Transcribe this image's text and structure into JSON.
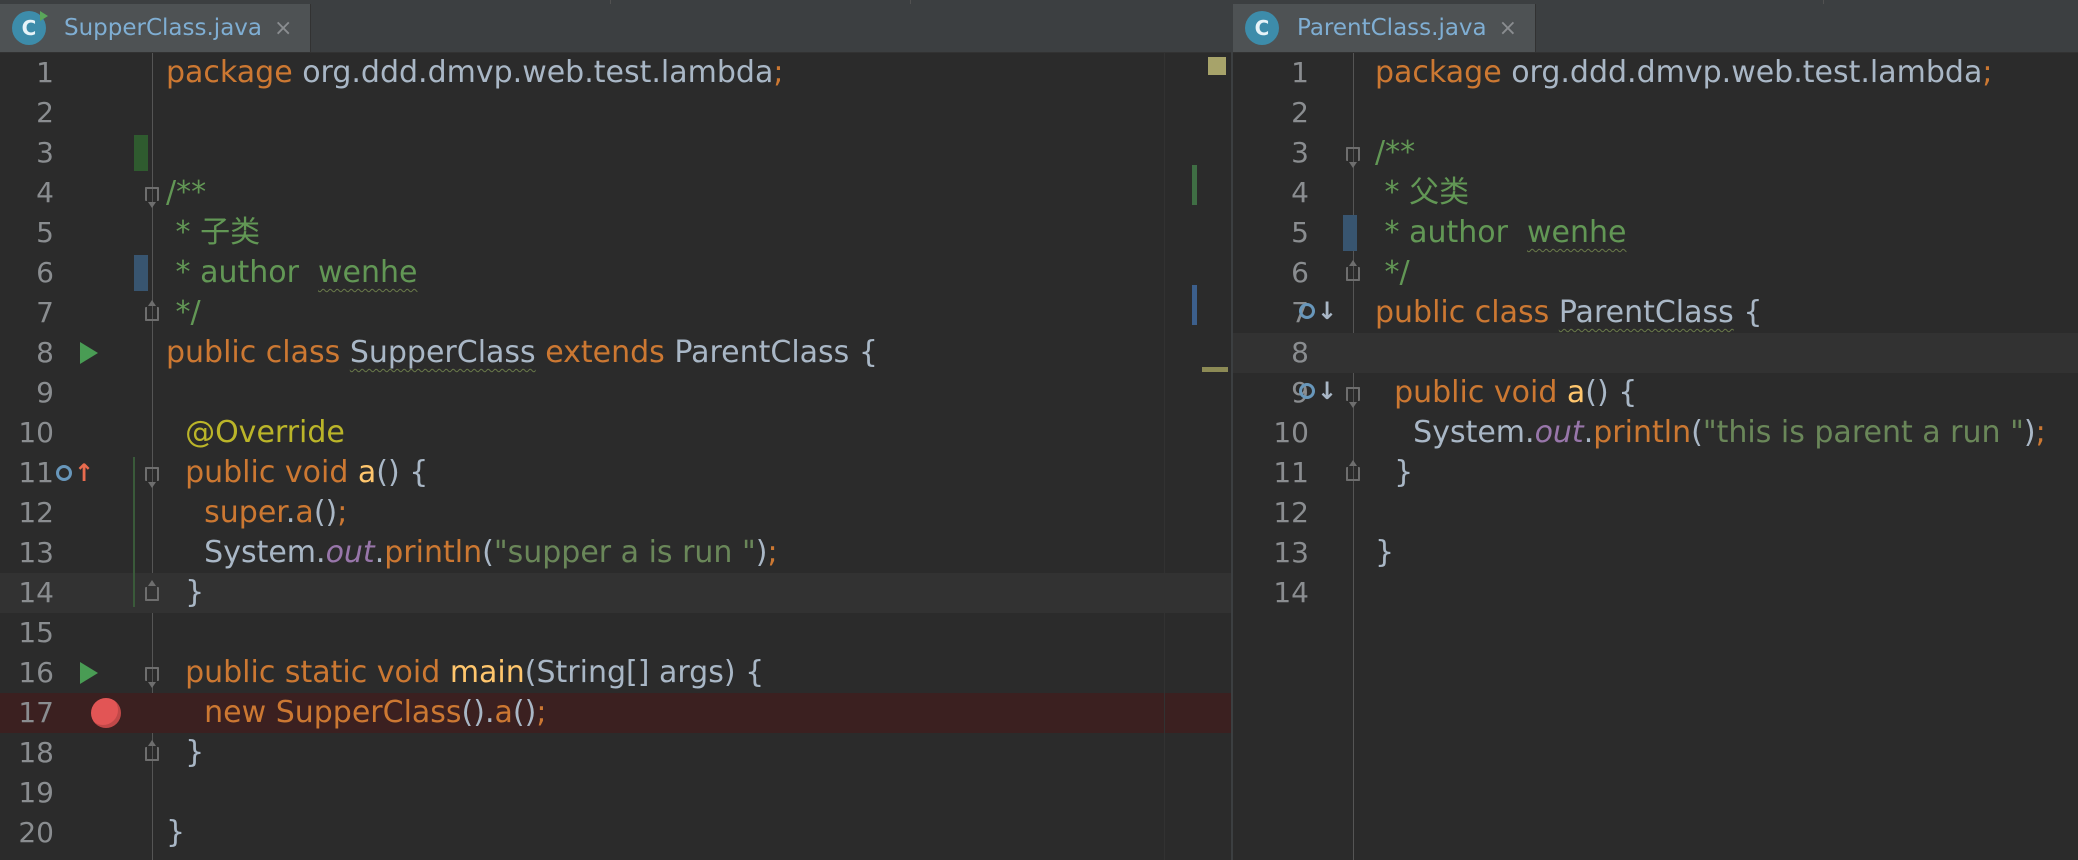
{
  "left": {
    "tab": {
      "icon": "class-file-icon",
      "filename": "SupperClass.java",
      "close": "×"
    },
    "lines": [
      {
        "n": "1",
        "tokens": [
          {
            "t": "package ",
            "c": "kw"
          },
          {
            "t": "org.ddd.dmvp.web.test.lambda",
            "c": "pl"
          },
          {
            "t": ";",
            "c": "kw"
          }
        ]
      },
      {
        "n": "2",
        "tokens": []
      },
      {
        "n": "3",
        "tokens": []
      },
      {
        "n": "4",
        "tokens": [
          {
            "t": "/**",
            "c": "cm"
          }
        ]
      },
      {
        "n": "5",
        "tokens": [
          {
            "t": " * 子类",
            "c": "cm"
          }
        ]
      },
      {
        "n": "6",
        "tokens": [
          {
            "t": " * author  ",
            "c": "cm"
          },
          {
            "t": "wenhe",
            "c": "cm",
            "w": 1
          }
        ]
      },
      {
        "n": "7",
        "tokens": [
          {
            "t": " */",
            "c": "cm"
          }
        ]
      },
      {
        "n": "8",
        "tokens": [
          {
            "t": "public class ",
            "c": "kw"
          },
          {
            "t": "SupperClass",
            "c": "pl",
            "w": 1
          },
          {
            "t": " extends ",
            "c": "kw"
          },
          {
            "t": "ParentClass {",
            "c": "pl"
          }
        ]
      },
      {
        "n": "9",
        "tokens": []
      },
      {
        "n": "10",
        "tokens": [
          {
            "t": "  @Override",
            "c": "an"
          }
        ]
      },
      {
        "n": "11",
        "tokens": [
          {
            "t": "  public void ",
            "c": "kw"
          },
          {
            "t": "a",
            "c": "fn"
          },
          {
            "t": "() {",
            "c": "pl"
          }
        ]
      },
      {
        "n": "12",
        "tokens": [
          {
            "t": "    super",
            "c": "kw"
          },
          {
            "t": ".",
            "c": "pl"
          },
          {
            "t": "a",
            "c": "kw"
          },
          {
            "t": "()",
            "c": "pl"
          },
          {
            "t": ";",
            "c": "kw"
          }
        ]
      },
      {
        "n": "13",
        "tokens": [
          {
            "t": "    System.",
            "c": "pl"
          },
          {
            "t": "out",
            "c": "fld"
          },
          {
            "t": ".",
            "c": "pl"
          },
          {
            "t": "println",
            "c": "kw"
          },
          {
            "t": "(",
            "c": "pl"
          },
          {
            "t": "\"supper a is run \"",
            "c": "st"
          },
          {
            "t": ")",
            "c": "pl"
          },
          {
            "t": ";",
            "c": "kw"
          }
        ]
      },
      {
        "n": "14",
        "tokens": [
          {
            "t": "  }",
            "c": "pl"
          }
        ],
        "current": true
      },
      {
        "n": "15",
        "tokens": []
      },
      {
        "n": "16",
        "tokens": [
          {
            "t": "  public static void ",
            "c": "kw"
          },
          {
            "t": "main",
            "c": "fn"
          },
          {
            "t": "(String[] args) {",
            "c": "pl"
          }
        ]
      },
      {
        "n": "17",
        "tokens": [
          {
            "t": "    new ",
            "c": "kw"
          },
          {
            "t": "SupperClass",
            "c": "kw"
          },
          {
            "t": "().",
            "c": "pl"
          },
          {
            "t": "a",
            "c": "kw"
          },
          {
            "t": "()",
            "c": "pl"
          },
          {
            "t": ";",
            "c": "kw"
          }
        ],
        "breakpoint": true
      },
      {
        "n": "18",
        "tokens": [
          {
            "t": "  }",
            "c": "pl"
          }
        ]
      },
      {
        "n": "19",
        "tokens": []
      },
      {
        "n": "20",
        "tokens": [
          {
            "t": "}",
            "c": "pl"
          }
        ]
      }
    ]
  },
  "right": {
    "tab": {
      "icon": "class-file-icon",
      "filename": "ParentClass.java",
      "close": "×"
    },
    "lines": [
      {
        "n": "1",
        "tokens": [
          {
            "t": "package ",
            "c": "kw"
          },
          {
            "t": "org.ddd.dmvp.web.test.lambda",
            "c": "pl"
          },
          {
            "t": ";",
            "c": "kw"
          }
        ]
      },
      {
        "n": "2",
        "tokens": []
      },
      {
        "n": "3",
        "tokens": [
          {
            "t": "/**",
            "c": "cm"
          }
        ]
      },
      {
        "n": "4",
        "tokens": [
          {
            "t": " * 父类",
            "c": "cm"
          }
        ]
      },
      {
        "n": "5",
        "tokens": [
          {
            "t": " * author  ",
            "c": "cm"
          },
          {
            "t": "wenhe",
            "c": "cm",
            "w": 1
          }
        ]
      },
      {
        "n": "6",
        "tokens": [
          {
            "t": " */",
            "c": "cm"
          }
        ]
      },
      {
        "n": "7",
        "tokens": [
          {
            "t": "public class ",
            "c": "kw"
          },
          {
            "t": "ParentClass",
            "c": "pl",
            "w": 1
          },
          {
            "t": " {",
            "c": "pl"
          }
        ]
      },
      {
        "n": "8",
        "tokens": [],
        "current": true
      },
      {
        "n": "9",
        "tokens": [
          {
            "t": "  public void ",
            "c": "kw"
          },
          {
            "t": "a",
            "c": "fn"
          },
          {
            "t": "() {",
            "c": "pl"
          }
        ]
      },
      {
        "n": "10",
        "tokens": [
          {
            "t": "    System.",
            "c": "pl"
          },
          {
            "t": "out",
            "c": "fld"
          },
          {
            "t": ".",
            "c": "pl"
          },
          {
            "t": "println",
            "c": "kw"
          },
          {
            "t": "(",
            "c": "pl"
          },
          {
            "t": "\"this is parent a run \"",
            "c": "st"
          },
          {
            "t": ")",
            "c": "pl"
          },
          {
            "t": ";",
            "c": "kw"
          }
        ]
      },
      {
        "n": "11",
        "tokens": [
          {
            "t": "  }",
            "c": "pl"
          }
        ]
      },
      {
        "n": "12",
        "tokens": []
      },
      {
        "n": "13",
        "tokens": [
          {
            "t": "}",
            "c": "pl"
          }
        ]
      },
      {
        "n": "14",
        "tokens": []
      }
    ]
  },
  "colors": {
    "keyword": "#cc7832",
    "plain": "#a9b7c6",
    "comment": "#629755",
    "string": "#6a8759",
    "annotation": "#bbb529",
    "method": "#ffc66d",
    "field": "#9876aa",
    "background": "#2b2b2b"
  },
  "icons": {
    "run": "run-gutter-icon",
    "breakpoint": "breakpoint-icon",
    "overrides": "overrides-method-icon",
    "overridden": "overridden-method-icon",
    "fold": "fold-icon"
  }
}
